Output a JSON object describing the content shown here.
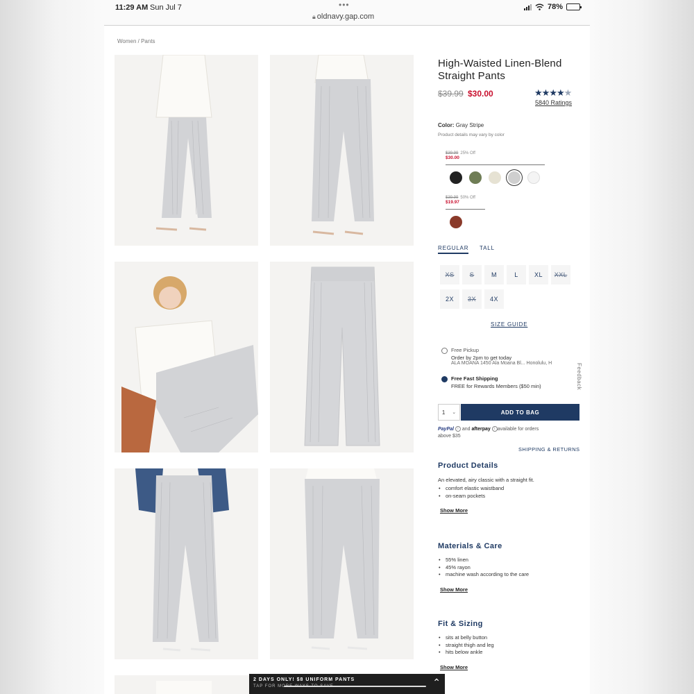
{
  "status_bar": {
    "time": "11:29 AM",
    "date": "Sun Jul 7",
    "url": "oldnavy.gap.com",
    "battery": "78%",
    "battery_level": 0.78
  },
  "breadcrumb": "Women / Pants",
  "product": {
    "title": "High-Waisted Linen-Blend Straight Pants",
    "price_original": "$39.99",
    "price_sale": "$30.00",
    "rating_stars": "★★★★★",
    "rating_value": 4.5,
    "ratings_count": "5840 Ratings"
  },
  "color": {
    "label": "Color:",
    "selected": "Gray Stripe",
    "note": "Product details may vary by color",
    "group1": {
      "original": "$39.99",
      "discount": "25% Off",
      "sale": "$30.00",
      "swatches": [
        {
          "name": "black",
          "hex": "#222222"
        },
        {
          "name": "olive",
          "hex": "#6f7d55"
        },
        {
          "name": "cream",
          "hex": "#e6e2d3"
        },
        {
          "name": "gray stripe",
          "hex": "#cfcfcf"
        },
        {
          "name": "white",
          "hex": "#f4f4f4"
        }
      ]
    },
    "group2": {
      "original": "$39.99",
      "discount": "50% Off",
      "sale": "$19.97",
      "swatches": [
        {
          "name": "rust",
          "hex": "#8a3a2a"
        }
      ]
    }
  },
  "fit_tabs": [
    "REGULAR",
    "TALL"
  ],
  "sizes": [
    {
      "label": "XS",
      "available": false
    },
    {
      "label": "S",
      "available": false
    },
    {
      "label": "M",
      "available": true
    },
    {
      "label": "L",
      "available": true
    },
    {
      "label": "XL",
      "available": true
    },
    {
      "label": "XXL",
      "available": false
    },
    {
      "label": "2X",
      "available": true
    },
    {
      "label": "3X",
      "available": false
    },
    {
      "label": "4X",
      "available": true
    }
  ],
  "size_guide": "SIZE GUIDE",
  "shipping": {
    "pickup_title": "Free Pickup",
    "pickup_line": "Order by 2pm to get today",
    "pickup_store": "ALA MOANA 1450 Ala Moana Bl...  Honolulu, H",
    "fast_title": "Free Fast Shipping",
    "fast_line": "FREE for Rewards Members ($50 min)"
  },
  "feedback": "Feedback",
  "qty": "1",
  "add_to_bag": "ADD TO BAG",
  "pay": {
    "paypal": "PayPal",
    "and": "and",
    "afterpay": "afterpay",
    "text": "available for orders",
    "text2": "above $35"
  },
  "shipping_returns": "SHIPPING & RETURNS",
  "sections": {
    "details": {
      "title": "Product Details",
      "intro": "An elevated, airy classic with a straight fit.",
      "items": [
        "comfort elastic waistband",
        "on-seam pockets"
      ],
      "more": "Show More"
    },
    "materials": {
      "title": "Materials & Care",
      "items": [
        "55% linen",
        "45% rayon",
        "machine wash according to the care"
      ],
      "more": "Show More"
    },
    "fit": {
      "title": "Fit & Sizing",
      "items": [
        "sits at belly button",
        "straight thigh and leg",
        "hits below ankle"
      ],
      "more": "Show More"
    }
  },
  "promo": {
    "main": "2 DAYS ONLY! $8 UNIFORM PANTS",
    "sub": "TAP FOR MORE WAYS TO SAVE"
  }
}
